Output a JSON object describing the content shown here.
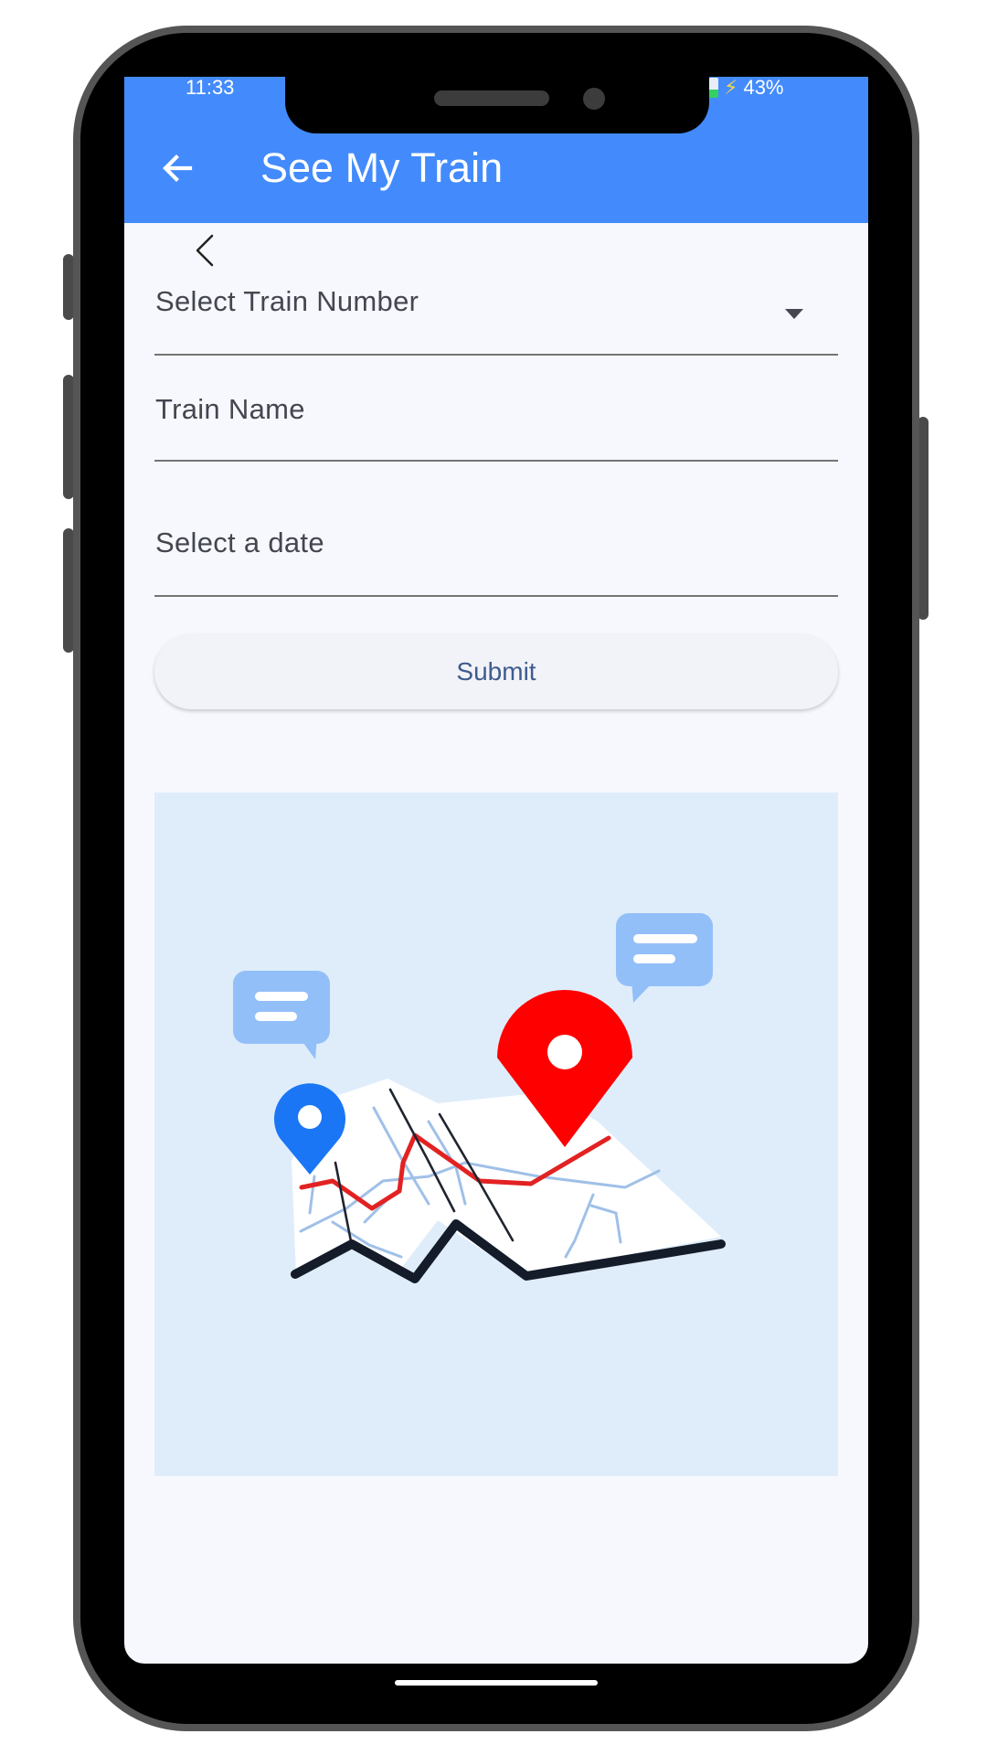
{
  "status_bar": {
    "time": "11:33",
    "battery": "43%"
  },
  "app_bar": {
    "title": "See My Train"
  },
  "form": {
    "train_number_label": "Select Train Number",
    "train_name_label": "Train Name",
    "date_label": "Select a date",
    "submit_label": "Submit"
  },
  "colors": {
    "app_bar": "#438bfc",
    "background": "#f7f8fe",
    "illustration_bg": "#dfedfb",
    "pin_red": "#ff0000",
    "pin_blue": "#1a76f5",
    "chat_bubble": "#93bff9"
  },
  "icons": {
    "back": "arrow-left-icon",
    "small_back": "chevron-left-icon",
    "dropdown": "caret-down-icon"
  }
}
